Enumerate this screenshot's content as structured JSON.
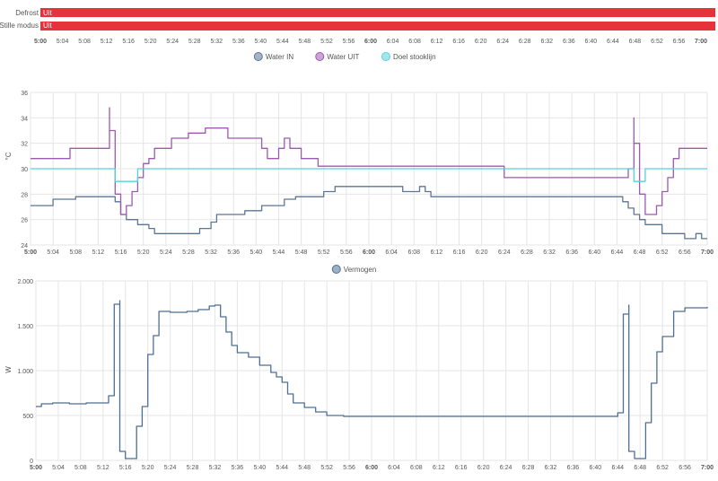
{
  "colors": {
    "timeline_bar": "#e8323b",
    "water_in": "#5b7695",
    "water_uit": "#9c59b0",
    "doel_stooklijn": "#56d2da",
    "vermogen": "#4e6f94",
    "grid": "#e5e5e5",
    "text": "#555555"
  },
  "timeline": {
    "rows": [
      {
        "label": "Defrost",
        "value": "Uit"
      },
      {
        "label": "Stille modus",
        "value": "Uit"
      }
    ],
    "x_ticks": [
      "5:00",
      "5:04",
      "5:08",
      "5:12",
      "5:16",
      "5:20",
      "5:24",
      "5:28",
      "5:32",
      "5:36",
      "5:40",
      "5:44",
      "5:48",
      "5:52",
      "5:56",
      "6:00",
      "6:04",
      "6:08",
      "6:12",
      "6:16",
      "6:20",
      "6:24",
      "6:28",
      "6:32",
      "6:36",
      "6:40",
      "6:44",
      "6:48",
      "6:52",
      "6:56",
      "7:00"
    ]
  },
  "chart_data": [
    {
      "type": "line",
      "ylabel": "°C",
      "ylim": [
        24,
        36
      ],
      "y_ticks": [
        "24",
        "26",
        "28",
        "30",
        "32",
        "34",
        "36"
      ],
      "xlim": [
        "5:00",
        "7:00"
      ],
      "x_ticks": [
        "5:00",
        "5:04",
        "5:08",
        "5:12",
        "5:16",
        "5:20",
        "5:24",
        "5:28",
        "5:32",
        "5:36",
        "5:40",
        "5:44",
        "5:48",
        "5:52",
        "5:56",
        "6:00",
        "6:04",
        "6:08",
        "6:12",
        "6:16",
        "6:20",
        "6:24",
        "6:28",
        "6:32",
        "6:36",
        "6:40",
        "6:44",
        "6:48",
        "6:52",
        "6:56",
        "7:00"
      ],
      "grid": true,
      "legend_position": "top-center",
      "series": [
        {
          "name": "Water IN",
          "step": true,
          "points": [
            [
              "5:00",
              27.1
            ],
            [
              "5:04",
              27.1
            ],
            [
              "5:04",
              27.6
            ],
            [
              "5:08",
              27.8
            ],
            [
              "5:15",
              27.8
            ],
            [
              "5:15",
              27.4
            ],
            [
              "5:16",
              26.4
            ],
            [
              "5:17",
              26.4
            ],
            [
              "5:17",
              26.0
            ],
            [
              "5:19",
              25.6
            ],
            [
              "5:21",
              25.3
            ],
            [
              "5:22",
              24.9
            ],
            [
              "5:30",
              24.9
            ],
            [
              "5:30",
              25.3
            ],
            [
              "5:32",
              25.8
            ],
            [
              "5:33",
              26.4
            ],
            [
              "5:38",
              26.4
            ],
            [
              "5:38",
              26.7
            ],
            [
              "5:41",
              27.1
            ],
            [
              "5:45",
              27.1
            ],
            [
              "5:45",
              27.6
            ],
            [
              "5:47",
              27.8
            ],
            [
              "5:52",
              27.8
            ],
            [
              "5:52",
              28.2
            ],
            [
              "5:54",
              28.6
            ],
            [
              "6:06",
              28.6
            ],
            [
              "6:06",
              28.2
            ],
            [
              "6:09",
              28.6
            ],
            [
              "6:10",
              28.2
            ],
            [
              "6:11",
              27.8
            ],
            [
              "6:45",
              27.8
            ],
            [
              "6:45",
              27.4
            ],
            [
              "6:46",
              26.9
            ],
            [
              "6:47",
              26.4
            ],
            [
              "6:48",
              26.0
            ],
            [
              "6:49",
              25.6
            ],
            [
              "6:52",
              25.6
            ],
            [
              "6:52",
              24.9
            ],
            [
              "6:56",
              24.9
            ],
            [
              "6:56",
              24.5
            ],
            [
              "6:58",
              24.9
            ],
            [
              "6:59",
              24.5
            ],
            [
              "7:00",
              24.5
            ]
          ]
        },
        {
          "name": "Water UIT",
          "step": true,
          "points": [
            [
              "5:00",
              30.8
            ],
            [
              "5:07",
              30.8
            ],
            [
              "5:07",
              31.6
            ],
            [
              "5:13",
              31.6
            ],
            [
              "5:14",
              34.8
            ],
            [
              "5:14",
              33.0
            ],
            [
              "5:15",
              30.0
            ],
            [
              "5:15",
              28.0
            ],
            [
              "5:16",
              26.4
            ],
            [
              "5:17",
              27.1
            ],
            [
              "5:18",
              28.2
            ],
            [
              "5:19",
              29.3
            ],
            [
              "5:20",
              30.4
            ],
            [
              "5:21",
              30.8
            ],
            [
              "5:22",
              31.6
            ],
            [
              "5:25",
              31.6
            ],
            [
              "5:25",
              32.4
            ],
            [
              "5:28",
              32.8
            ],
            [
              "5:31",
              33.2
            ],
            [
              "5:35",
              33.2
            ],
            [
              "5:35",
              32.4
            ],
            [
              "5:41",
              32.4
            ],
            [
              "5:41",
              31.6
            ],
            [
              "5:42",
              31.6
            ],
            [
              "5:42",
              30.8
            ],
            [
              "5:43",
              30.8
            ],
            [
              "5:44",
              31.6
            ],
            [
              "5:45",
              32.4
            ],
            [
              "5:46",
              31.6
            ],
            [
              "5:48",
              31.6
            ],
            [
              "5:48",
              30.8
            ],
            [
              "5:51",
              30.8
            ],
            [
              "5:51",
              30.2
            ],
            [
              "6:24",
              30.2
            ],
            [
              "6:24",
              29.3
            ],
            [
              "6:33",
              29.3
            ],
            [
              "6:33",
              29.3
            ],
            [
              "6:46",
              29.3
            ],
            [
              "6:46",
              30.0
            ],
            [
              "6:47",
              34.0
            ],
            [
              "6:47",
              32.0
            ],
            [
              "6:48",
              28.0
            ],
            [
              "6:49",
              26.4
            ],
            [
              "6:50",
              26.4
            ],
            [
              "6:51",
              27.1
            ],
            [
              "6:52",
              28.2
            ],
            [
              "6:53",
              29.3
            ],
            [
              "6:54",
              30.8
            ],
            [
              "6:55",
              31.6
            ],
            [
              "7:00",
              31.6
            ]
          ]
        },
        {
          "name": "Doel stooklijn",
          "step": true,
          "points": [
            [
              "5:00",
              30.0
            ],
            [
              "5:15",
              30.0
            ],
            [
              "5:15",
              29.0
            ],
            [
              "5:19",
              29.0
            ],
            [
              "5:19",
              30.0
            ],
            [
              "6:47",
              30.0
            ],
            [
              "6:47",
              29.0
            ],
            [
              "6:49",
              29.0
            ],
            [
              "6:49",
              30.0
            ],
            [
              "7:00",
              30.0
            ]
          ]
        }
      ]
    },
    {
      "type": "line",
      "ylabel": "W",
      "ylim": [
        0,
        2000
      ],
      "y_ticks": [
        "0",
        "500",
        "1.000",
        "1.500",
        "2.000"
      ],
      "xlim": [
        "5:00",
        "7:00"
      ],
      "x_ticks": [
        "5:00",
        "5:04",
        "5:08",
        "5:12",
        "5:16",
        "5:20",
        "5:24",
        "5:28",
        "5:32",
        "5:36",
        "5:40",
        "5:44",
        "5:48",
        "5:52",
        "5:56",
        "6:00",
        "6:04",
        "6:08",
        "6:12",
        "6:16",
        "6:20",
        "6:24",
        "6:28",
        "6:32",
        "6:36",
        "6:40",
        "6:44",
        "6:48",
        "6:52",
        "6:56",
        "7:00"
      ],
      "grid": true,
      "legend_position": "top-center",
      "series": [
        {
          "name": "Vermogen",
          "step": true,
          "points": [
            [
              "5:00",
              600
            ],
            [
              "5:01",
              630
            ],
            [
              "5:03",
              640
            ],
            [
              "5:06",
              630
            ],
            [
              "5:09",
              640
            ],
            [
              "5:13",
              640
            ],
            [
              "5:13",
              720
            ],
            [
              "5:14",
              1740
            ],
            [
              "5:15",
              1780
            ],
            [
              "5:15",
              100
            ],
            [
              "5:16",
              20
            ],
            [
              "5:18",
              20
            ],
            [
              "5:18",
              380
            ],
            [
              "5:19",
              600
            ],
            [
              "5:20",
              1180
            ],
            [
              "5:21",
              1390
            ],
            [
              "5:22",
              1660
            ],
            [
              "5:24",
              1650
            ],
            [
              "5:27",
              1660
            ],
            [
              "5:29",
              1680
            ],
            [
              "5:31",
              1720
            ],
            [
              "5:32",
              1730
            ],
            [
              "5:33",
              1600
            ],
            [
              "5:34",
              1430
            ],
            [
              "5:35",
              1280
            ],
            [
              "5:36",
              1200
            ],
            [
              "5:38",
              1150
            ],
            [
              "5:40",
              1060
            ],
            [
              "5:42",
              980
            ],
            [
              "5:43",
              930
            ],
            [
              "5:44",
              870
            ],
            [
              "5:45",
              740
            ],
            [
              "5:46",
              640
            ],
            [
              "5:48",
              590
            ],
            [
              "5:50",
              540
            ],
            [
              "5:52",
              500
            ],
            [
              "5:55",
              490
            ],
            [
              "6:00",
              490
            ],
            [
              "6:20",
              490
            ],
            [
              "6:40",
              490
            ],
            [
              "6:44",
              530
            ],
            [
              "6:45",
              1630
            ],
            [
              "6:46",
              1730
            ],
            [
              "6:46",
              100
            ],
            [
              "6:47",
              20
            ],
            [
              "6:49",
              20
            ],
            [
              "6:49",
              420
            ],
            [
              "6:50",
              860
            ],
            [
              "6:51",
              1210
            ],
            [
              "6:52",
              1380
            ],
            [
              "6:54",
              1660
            ],
            [
              "6:56",
              1700
            ],
            [
              "7:00",
              1710
            ]
          ]
        }
      ]
    }
  ]
}
